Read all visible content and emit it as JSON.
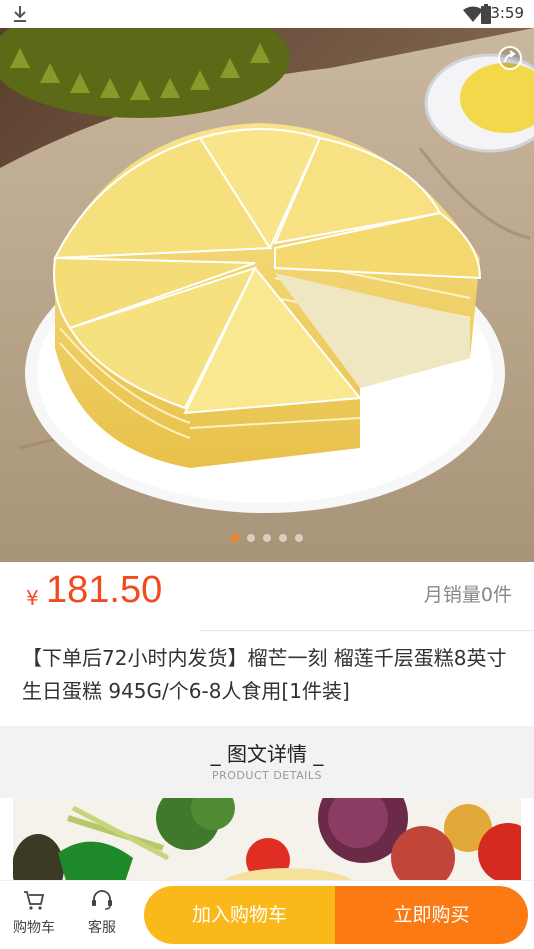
{
  "status_bar": {
    "time": "3:59"
  },
  "gallery": {
    "total_images": 5,
    "current_index": 1
  },
  "product": {
    "currency_symbol": "¥",
    "price": "181.50",
    "monthly_sales": "月销量0件",
    "title": "【下单后72小时内发货】榴芒一刻 榴莲千层蛋糕8英寸 生日蛋糕 945G/个6-8人食用[1件装]"
  },
  "details": {
    "title": "_ 图文详情 _",
    "subtitle": "PRODUCT DETAILS"
  },
  "bottom_bar": {
    "cart_label": "购物车",
    "service_label": "客服",
    "add_to_cart": "加入购物车",
    "buy_now": "立即购买"
  },
  "colors": {
    "price": "#f24a1f",
    "add_to_cart_bg": "#fbb81a",
    "buy_now_bg": "#fb7a14"
  }
}
